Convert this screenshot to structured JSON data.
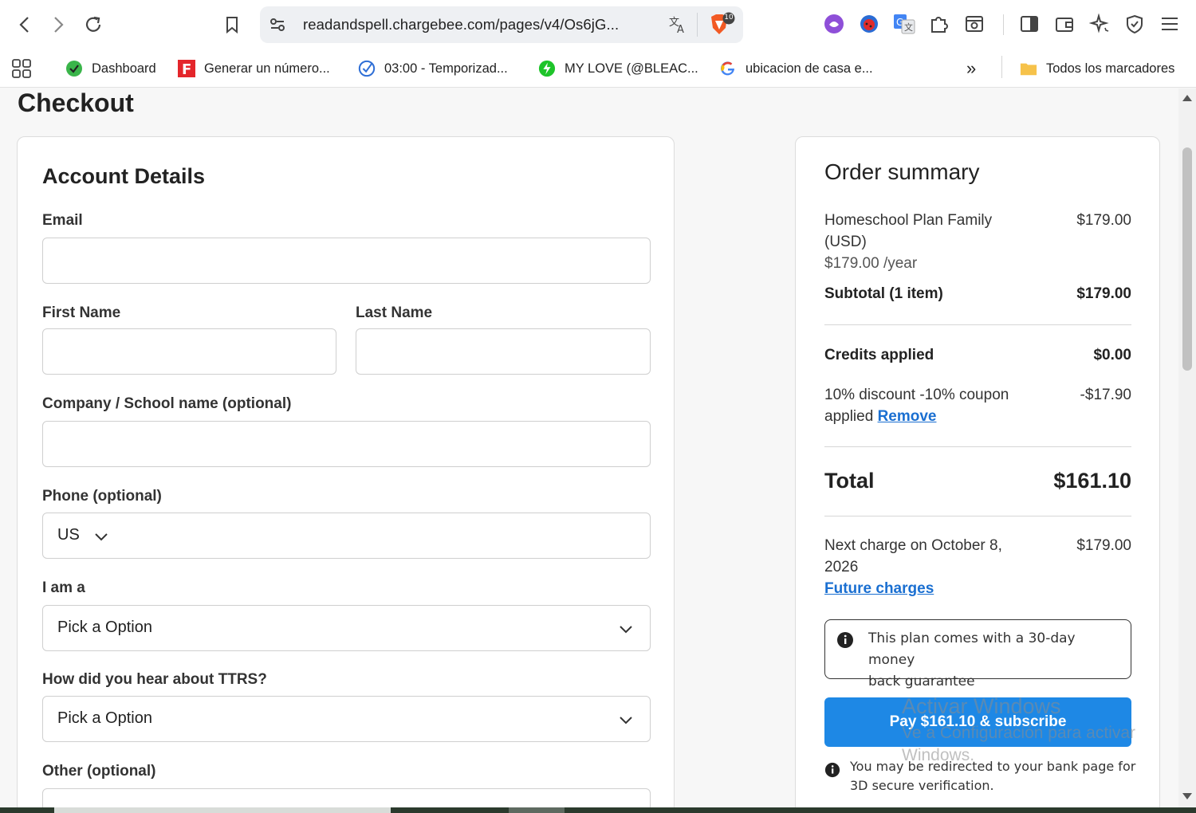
{
  "browser": {
    "url": "readandspell.chargebee.com/pages/v4/Os6jG...",
    "shield_badge": "10",
    "bookmarks": [
      {
        "label": "Dashboard"
      },
      {
        "label": "Generar un número..."
      },
      {
        "label": "03:00 - Temporizad..."
      },
      {
        "label": "MY LOVE (@BLEAC..."
      },
      {
        "label": "ubicacion de casa e..."
      }
    ],
    "more_bookmarks": "»",
    "all_bookmarks": "Todos los marcadores"
  },
  "page": {
    "title": "Checkout"
  },
  "account": {
    "heading": "Account Details",
    "email_label": "Email",
    "first_name_label": "First Name",
    "last_name_label": "Last Name",
    "company_label": "Company / School name (optional)",
    "phone_label": "Phone (optional)",
    "phone_country": "US",
    "i_am_label": "I am a",
    "i_am_value": "Pick a Option",
    "hear_label": "How did you hear about TTRS?",
    "hear_value": "Pick a Option",
    "other_label": "Other (optional)"
  },
  "summary": {
    "heading": "Order summary",
    "plan_name_1": "Homeschool Plan Family",
    "plan_name_2": "(USD)",
    "plan_price": "$179.00",
    "plan_rate": "$179.00 /year",
    "subtotal_label": "Subtotal (1 item)",
    "subtotal_value": "$179.00",
    "credits_label": "Credits applied",
    "credits_value": "$0.00",
    "discount_label_1": "10% discount -10% coupon",
    "discount_label_2": "applied",
    "discount_remove": "Remove",
    "discount_value": "-$17.90",
    "total_label": "Total",
    "total_value": "$161.10",
    "next_charge_1": "Next charge on October 8,",
    "next_charge_2": "2026",
    "next_charge_value": "$179.00",
    "future_charges": "Future charges",
    "guarantee_1": "This plan comes with a 30-day money",
    "guarantee_2": "back guarantee",
    "pay_button": "Pay $161.10 & subscribe",
    "redirect_1": "You may be redirected to your bank page for",
    "redirect_2": "3D secure verification."
  },
  "watermark": {
    "line1": "Activar Windows",
    "line2": "Ve a Configuración para activar",
    "line3": "Windows."
  }
}
